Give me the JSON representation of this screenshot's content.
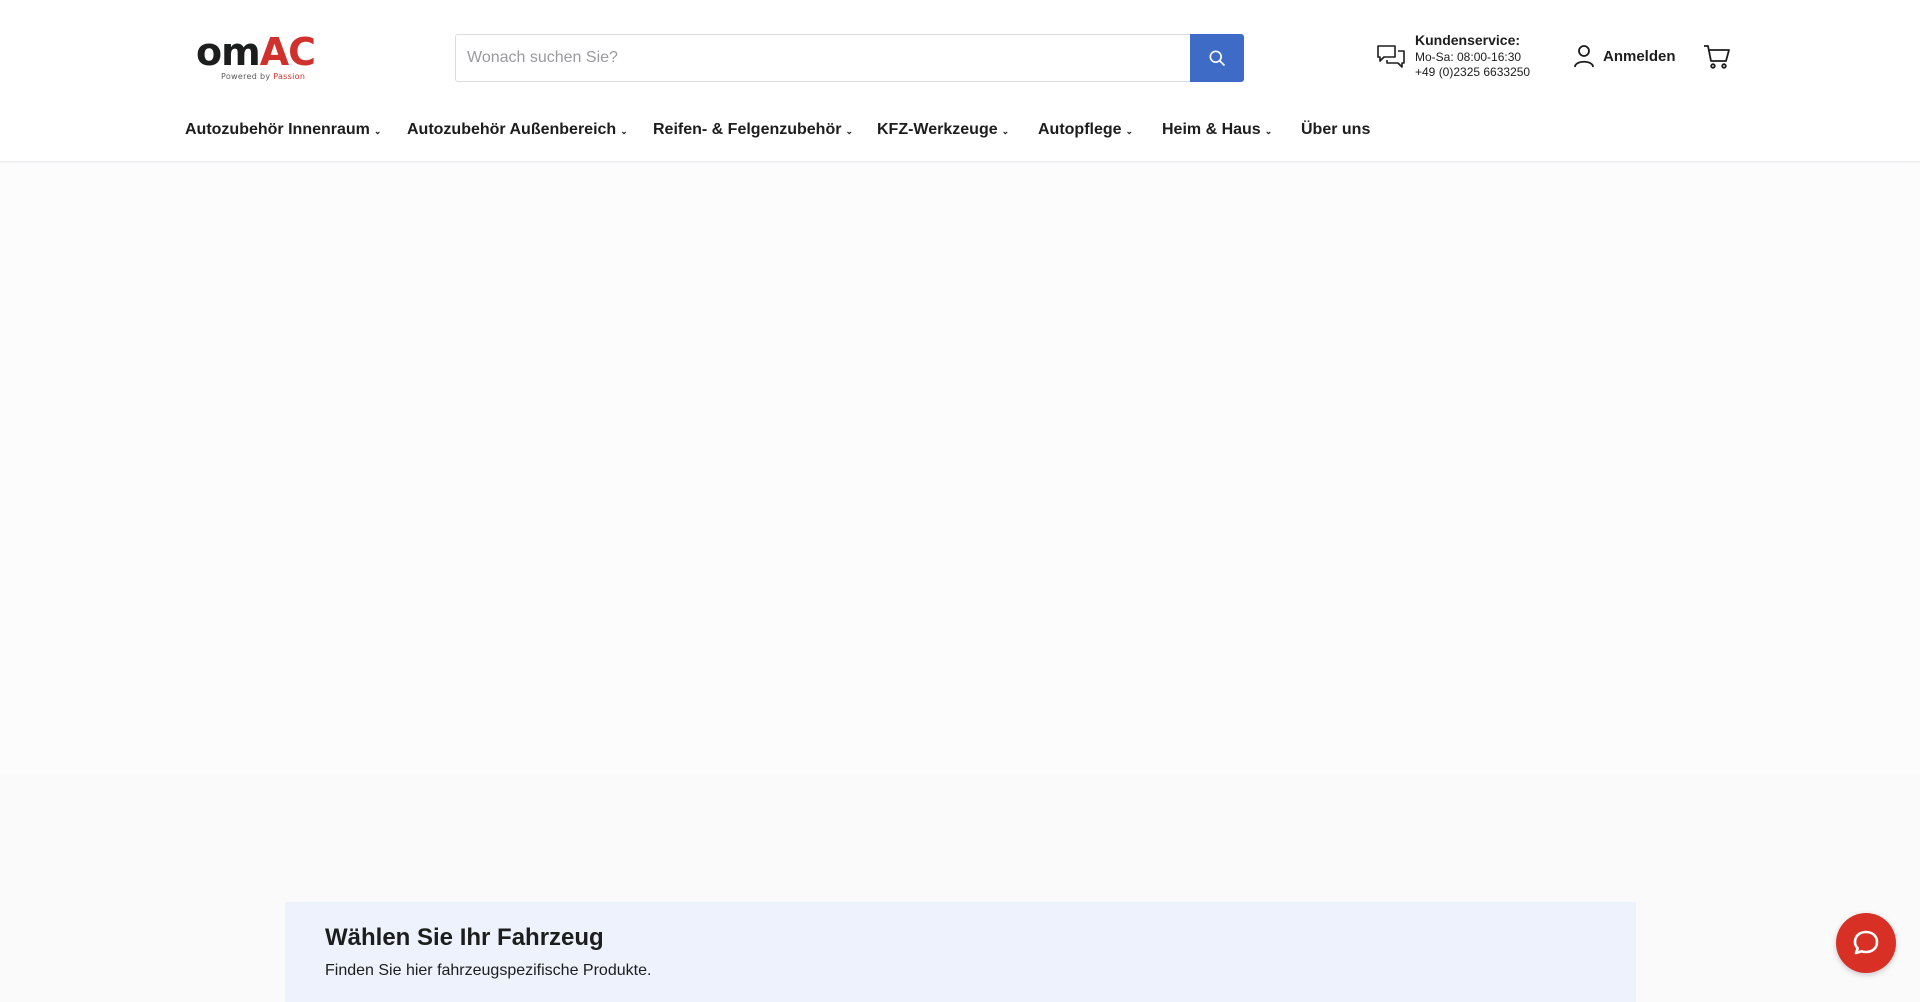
{
  "brand": {
    "logo_text_dark": "om",
    "logo_text_red": "AC",
    "tagline_prefix": "Powered by",
    "tagline_highlight": "Passion",
    "accent_color": "#d0312d",
    "button_color": "#3e6bc5"
  },
  "search": {
    "placeholder": "Wonach suchen Sie?",
    "value": "",
    "button_icon": "search-icon"
  },
  "service": {
    "icon": "chat-bubbles-icon",
    "title": "Kundenservice:",
    "hours": "Mo-Sa: 08:00-16:30",
    "phone": "+49 (0)2325 6633250"
  },
  "account": {
    "icon": "user-icon",
    "label": "Anmelden"
  },
  "cart": {
    "icon": "cart-icon"
  },
  "nav": {
    "items": [
      {
        "label": "Autozubehör Innenraum",
        "has_dropdown": true
      },
      {
        "label": "Autozubehör Außenbereich",
        "has_dropdown": true
      },
      {
        "label": "Reifen- & Felgenzubehör",
        "has_dropdown": true
      },
      {
        "label": "KFZ-Werkzeuge",
        "has_dropdown": true
      },
      {
        "label": "Autopflege",
        "has_dropdown": true
      },
      {
        "label": "Heim & Haus",
        "has_dropdown": true
      },
      {
        "label": "Über uns",
        "has_dropdown": false
      }
    ],
    "chevron": "⌄"
  },
  "vehicle_selector": {
    "title": "Wählen Sie Ihr Fahrzeug",
    "subtitle": "Finden Sie hier fahrzeugspezifische Produkte."
  },
  "chat_widget": {
    "icon": "chat-icon",
    "color": "#d93025"
  }
}
